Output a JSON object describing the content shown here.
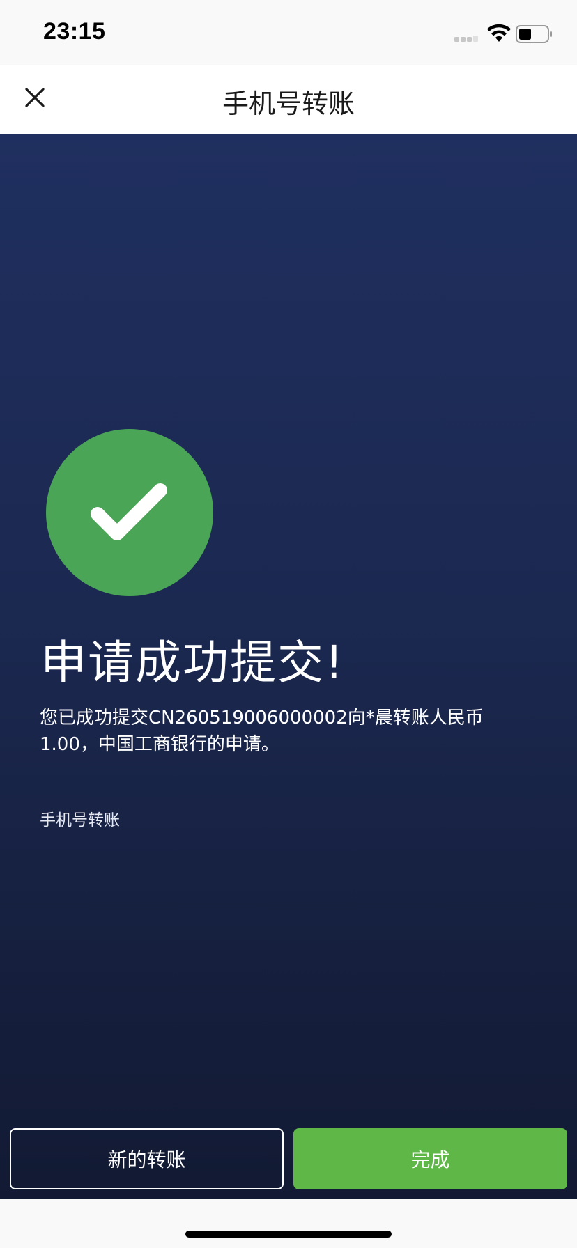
{
  "status_bar": {
    "time": "23:15"
  },
  "nav": {
    "title": "手机号转账",
    "close_icon": "close-icon"
  },
  "result": {
    "icon": "check-icon",
    "icon_color": "#4ba556",
    "headline": "申请成功提交!",
    "message": "您已成功提交CN260519006000002向*晨转账人民币1.00，中国工商银行的申请。",
    "transfer_type": "手机号转账"
  },
  "actions": {
    "new_transfer_label": "新的转账",
    "done_label": "完成",
    "done_color": "#5fb747"
  },
  "colors": {
    "background_top": "#1f2f5f",
    "background_bottom": "#121a33"
  }
}
